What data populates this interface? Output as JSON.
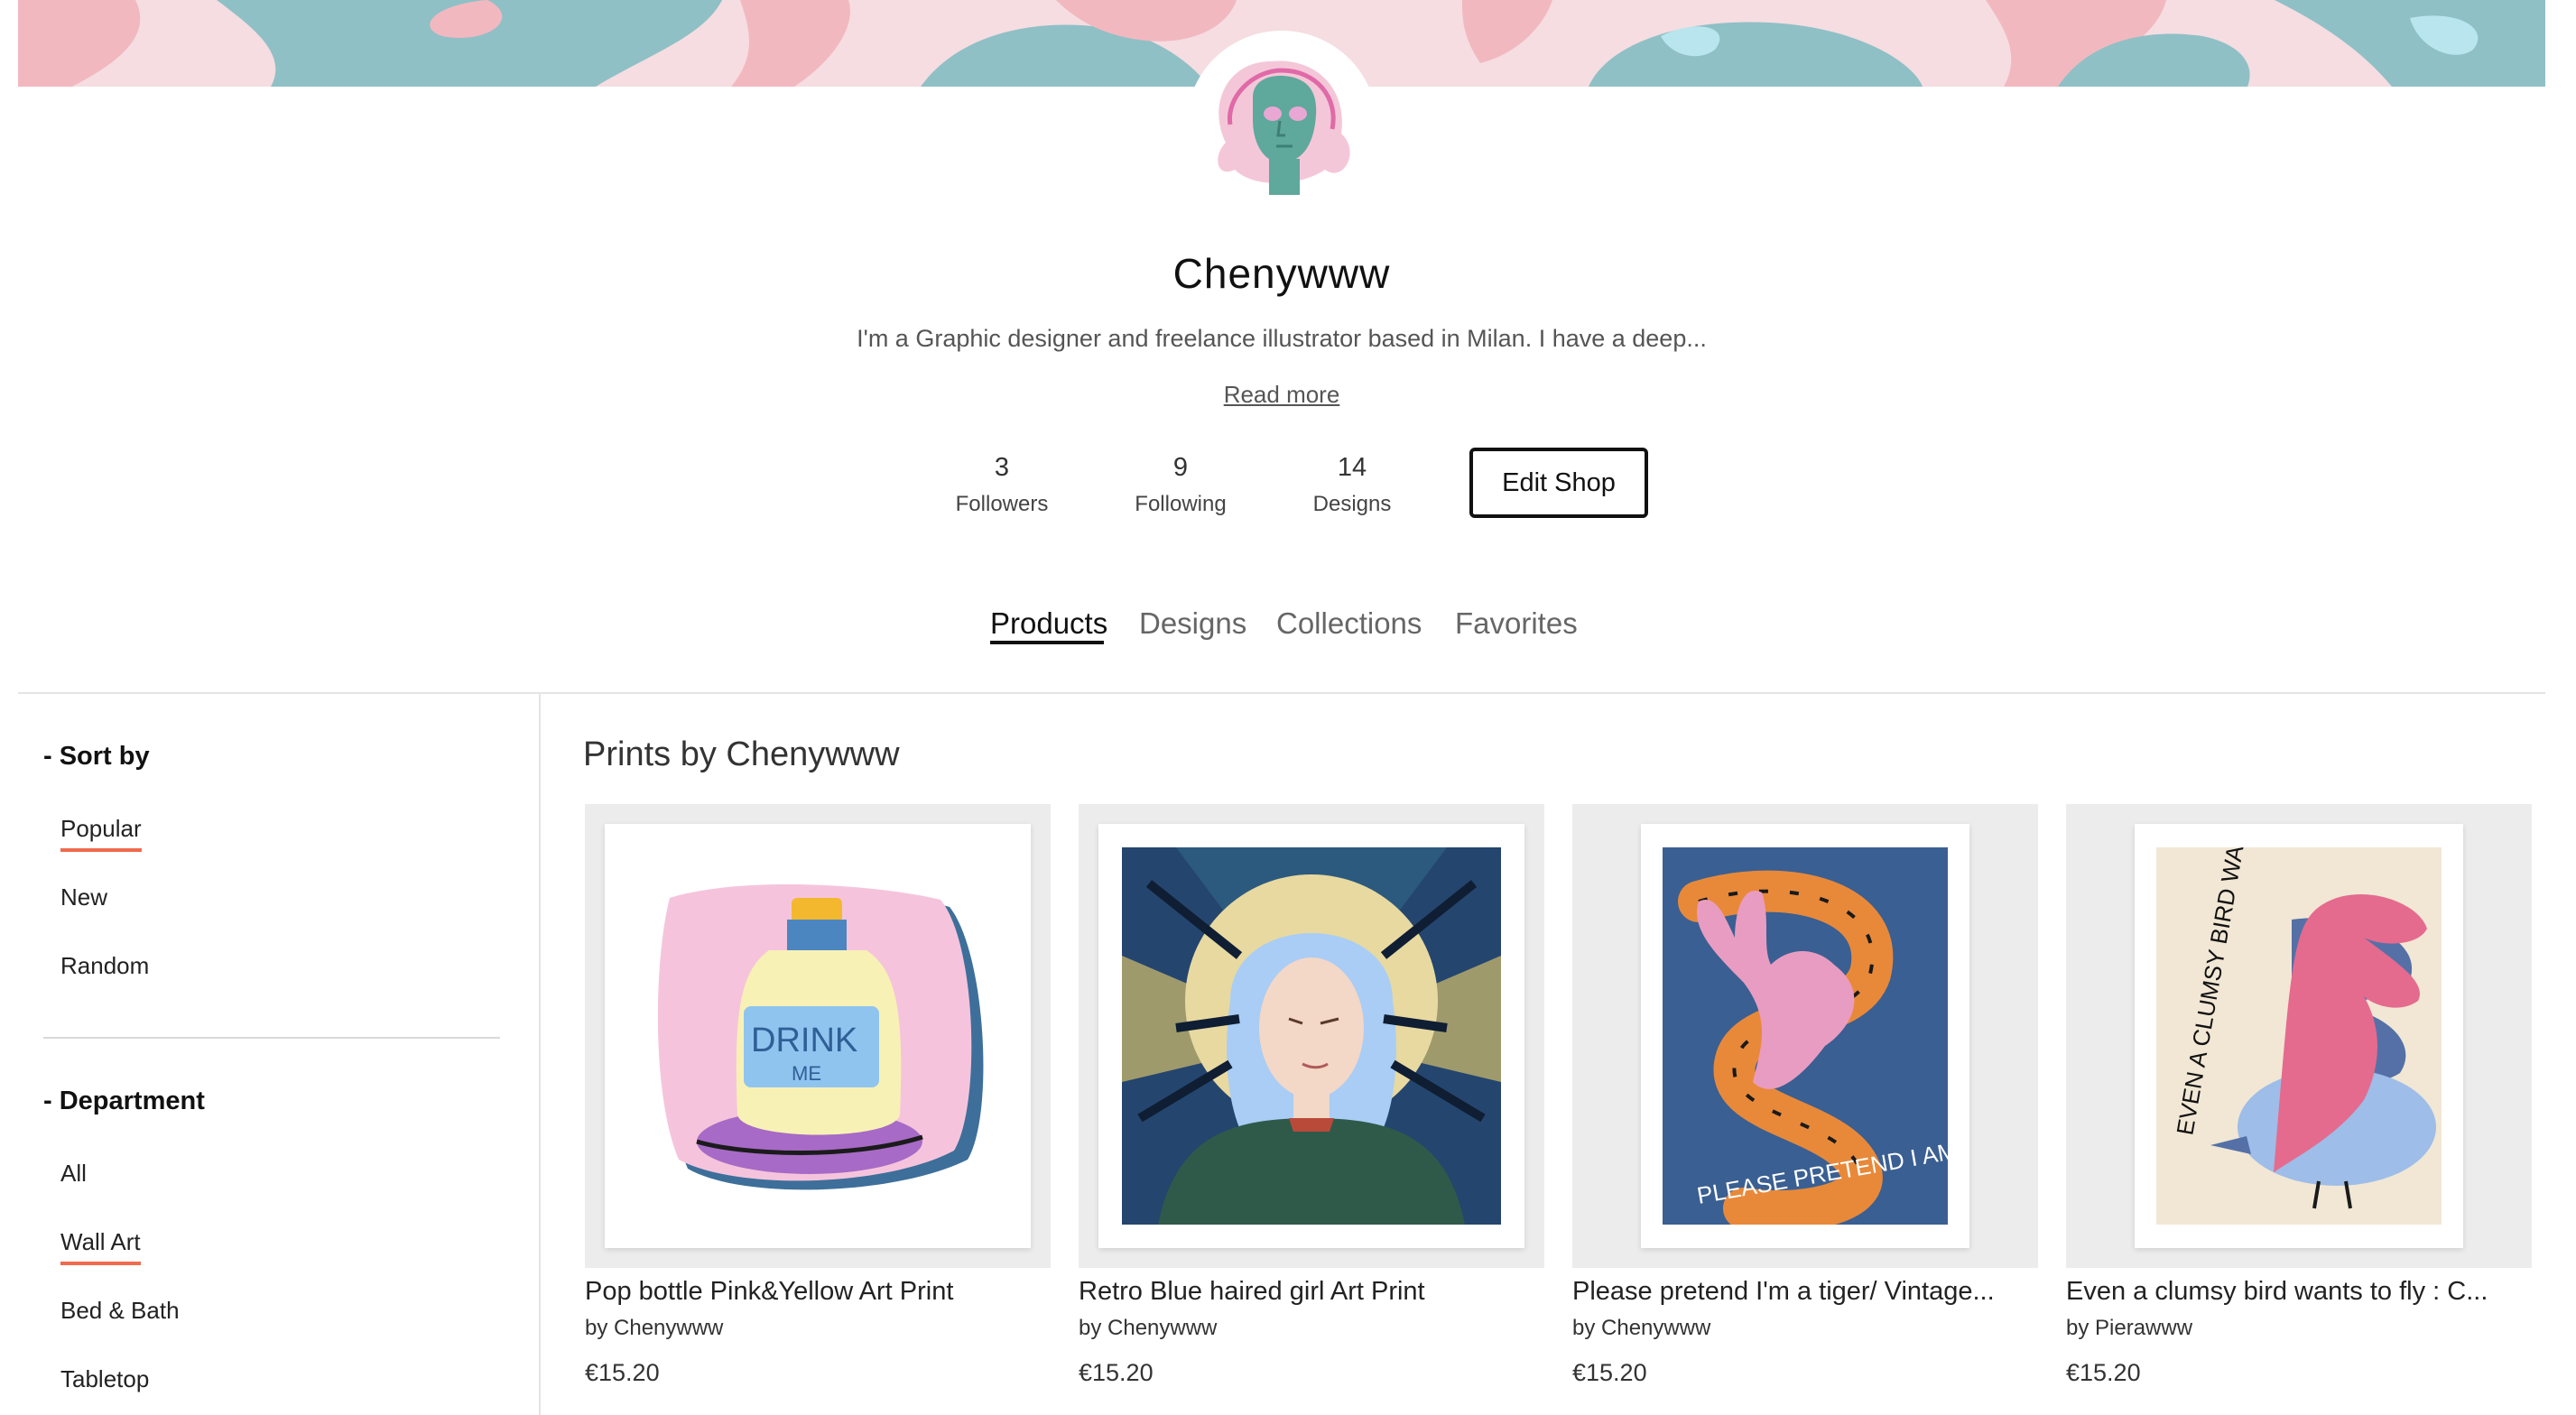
{
  "profile": {
    "name": "Chenywww",
    "bio": "I'm a Graphic designer and freelance illustrator based in Milan. I have a deep...",
    "read_more": "Read more"
  },
  "stats": [
    {
      "value": "3",
      "label": "Followers"
    },
    {
      "value": "9",
      "label": "Following"
    },
    {
      "value": "14",
      "label": "Designs"
    }
  ],
  "edit_shop_label": "Edit Shop",
  "tabs": [
    {
      "label": "Products",
      "active": true
    },
    {
      "label": "Designs",
      "active": false
    },
    {
      "label": "Collections",
      "active": false
    },
    {
      "label": "Favorites",
      "active": false
    }
  ],
  "sidebar": {
    "sort_heading": "- Sort by",
    "sort_options": [
      {
        "label": "Popular",
        "selected": true
      },
      {
        "label": "New",
        "selected": false
      },
      {
        "label": "Random",
        "selected": false
      }
    ],
    "department_heading": "- Department",
    "departments": [
      {
        "label": "All",
        "selected": false
      },
      {
        "label": "Wall Art",
        "selected": true
      },
      {
        "label": "Bed & Bath",
        "selected": false
      },
      {
        "label": "Tabletop",
        "selected": false
      }
    ]
  },
  "products_section": {
    "title": "Prints by Chenywww",
    "items": [
      {
        "title": "Pop bottle Pink&Yellow Art Print",
        "by": "by Chenywww",
        "price": "€15.20"
      },
      {
        "title": "Retro Blue haired girl Art Print",
        "by": "by Chenywww",
        "price": "€15.20"
      },
      {
        "title": "Please pretend I'm a tiger/ Vintage...",
        "by": "by Chenywww",
        "price": "€15.20"
      },
      {
        "title": "Even a clumsy bird wants to fly : C...",
        "by": "by Pierawww",
        "price": "€15.20"
      }
    ]
  },
  "artwork_text": {
    "drink": "DRINK",
    "me": "ME",
    "tiger_text": "PLEASE PRETEND I AM A TIGER",
    "bird_text": "EVEN A CLUMSY BIRD WANTS TO FLY"
  },
  "colors": {
    "accent_underline": "#f06a4f",
    "banner_teal": "#8fc0c6",
    "banner_pink": "#f5dde1"
  }
}
